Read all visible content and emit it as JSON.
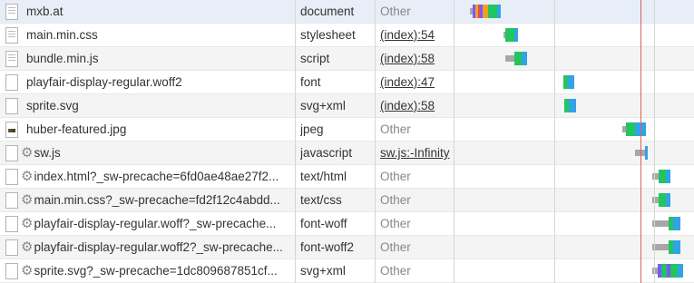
{
  "colors": {
    "selected_row": "#e8eef8",
    "alt_row": "#f4f4f4",
    "waiting": "#a7a7a7",
    "content_download": "#31a3e6",
    "receiving": "#22c55e",
    "queueing": "#7a5af8",
    "dns": "#f0a020",
    "connect": "#d9534f",
    "load_marker": "#e0605c"
  },
  "requests": [
    {
      "name": "mxb.at",
      "type": "document",
      "initiator": "Other",
      "icon": "doc",
      "sw": false,
      "initiator_link": false
    },
    {
      "name": "main.min.css",
      "type": "stylesheet",
      "initiator": "(index):54",
      "icon": "doc",
      "sw": false,
      "initiator_link": true
    },
    {
      "name": "bundle.min.js",
      "type": "script",
      "initiator": "(index):58",
      "icon": "doc",
      "sw": false,
      "initiator_link": true
    },
    {
      "name": "playfair-display-regular.woff2",
      "type": "font",
      "initiator": "(index):47",
      "icon": "blank",
      "sw": false,
      "initiator_link": true
    },
    {
      "name": "sprite.svg",
      "type": "svg+xml",
      "initiator": "(index):58",
      "icon": "blank",
      "sw": false,
      "initiator_link": true
    },
    {
      "name": "huber-featured.jpg",
      "type": "jpeg",
      "initiator": "Other",
      "icon": "img",
      "sw": false,
      "initiator_link": false
    },
    {
      "name": "sw.js",
      "type": "javascript",
      "initiator": "sw.js:-Infinity",
      "icon": "blank",
      "sw": true,
      "initiator_link": true
    },
    {
      "name": "index.html?_sw-precache=6fd0ae48ae27f2...",
      "type": "text/html",
      "initiator": "Other",
      "icon": "blank",
      "sw": true,
      "initiator_link": false
    },
    {
      "name": "main.min.css?_sw-precache=fd2f12c4abdd...",
      "type": "text/css",
      "initiator": "Other",
      "icon": "blank",
      "sw": true,
      "initiator_link": false
    },
    {
      "name": "playfair-display-regular.woff?_sw-precache...",
      "type": "font-woff",
      "initiator": "Other",
      "icon": "blank",
      "sw": true,
      "initiator_link": false
    },
    {
      "name": "playfair-display-regular.woff2?_sw-precache...",
      "type": "font-woff2",
      "initiator": "Other",
      "icon": "blank",
      "sw": true,
      "initiator_link": false
    },
    {
      "name": "sprite.svg?_sw-precache=1dc809687851cf...",
      "type": "svg+xml",
      "initiator": "Other",
      "icon": "blank",
      "sw": true,
      "initiator_link": false
    }
  ]
}
